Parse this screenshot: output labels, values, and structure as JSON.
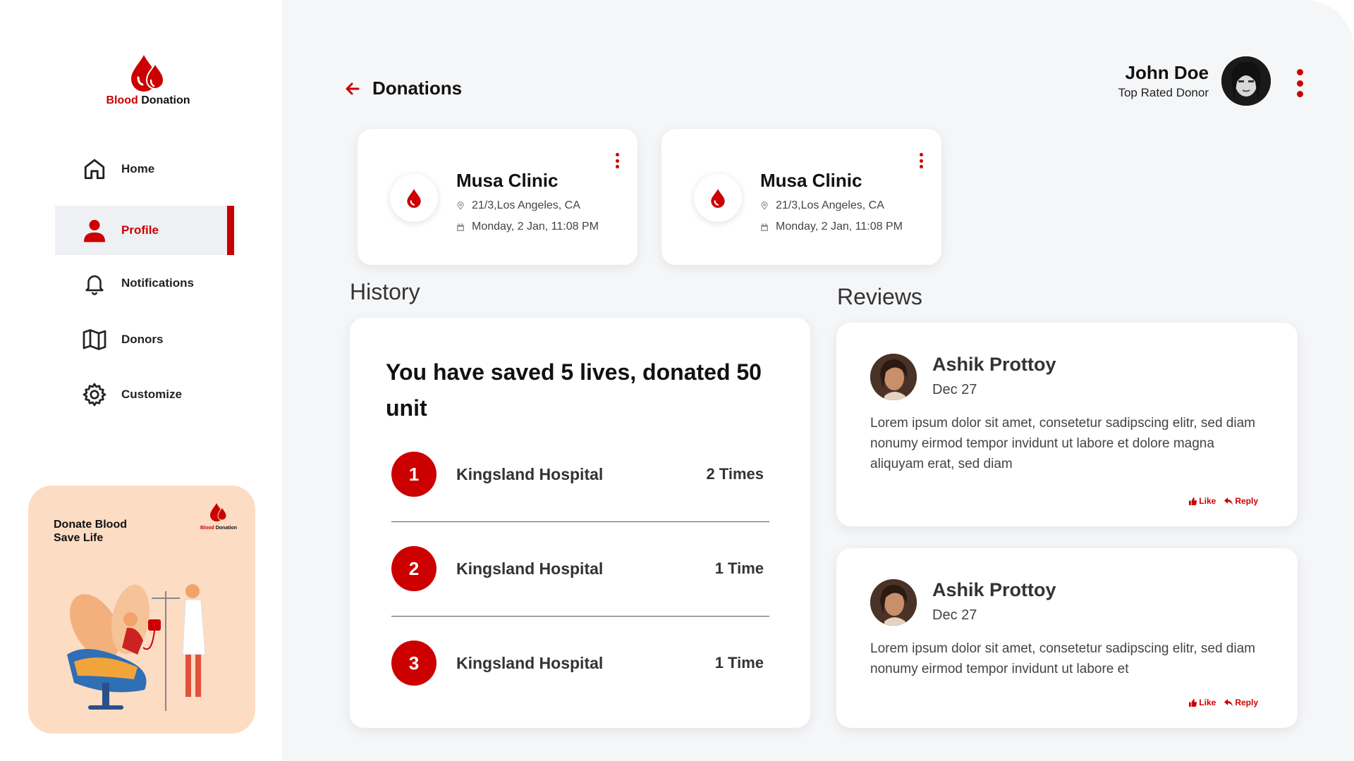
{
  "brand": {
    "part1": "Blood",
    "part2": " Donation"
  },
  "nav": [
    {
      "label": "Home",
      "icon": "home-icon"
    },
    {
      "label": "Profile",
      "icon": "user-icon",
      "active": true
    },
    {
      "label": "Notifications",
      "icon": "bell-icon"
    },
    {
      "label": "Donors",
      "icon": "map-icon"
    },
    {
      "label": "Customize",
      "icon": "gear-icon"
    }
  ],
  "promo": {
    "line1": "Donate Blood",
    "line2": "Save Life"
  },
  "header": {
    "title": "Donations"
  },
  "user": {
    "name": "John Doe",
    "role": "Top Rated Donor"
  },
  "donation_cards": [
    {
      "clinic": "Musa Clinic",
      "address": "21/3,Los Angeles, CA",
      "datetime": "Monday, 2 Jan, 11:08 PM"
    },
    {
      "clinic": "Musa Clinic",
      "address": "21/3,Los Angeles, CA",
      "datetime": "Monday, 2 Jan, 11:08 PM"
    }
  ],
  "history": {
    "title": "History",
    "headline": "You have saved 5 lives, donated 50 unit",
    "rows": [
      {
        "rank": "1",
        "hospital": "Kingsland Hospital",
        "count": "2 Times"
      },
      {
        "rank": "2",
        "hospital": "Kingsland Hospital",
        "count": "1 Time"
      },
      {
        "rank": "3",
        "hospital": "Kingsland Hospital",
        "count": "1 Time"
      }
    ]
  },
  "reviews": {
    "title": "Reviews",
    "items": [
      {
        "name": "Ashik Prottoy",
        "date": "Dec 27",
        "text": "Lorem ipsum dolor sit amet, consetetur sadipscing elitr, sed diam nonumy eirmod tempor invidunt ut labore et dolore magna aliquyam erat, sed diam",
        "like": "Like",
        "reply": "Reply"
      },
      {
        "name": "Ashik Prottoy",
        "date": "Dec 27",
        "text": "Lorem ipsum dolor sit amet, consetetur sadipscing elitr, sed diam nonumy eirmod tempor invidunt ut labore et",
        "like": "Like",
        "reply": "Reply"
      }
    ]
  },
  "colors": {
    "accent": "#cc0000",
    "background": "#f5f6f8",
    "promo": "#fddcc4"
  }
}
